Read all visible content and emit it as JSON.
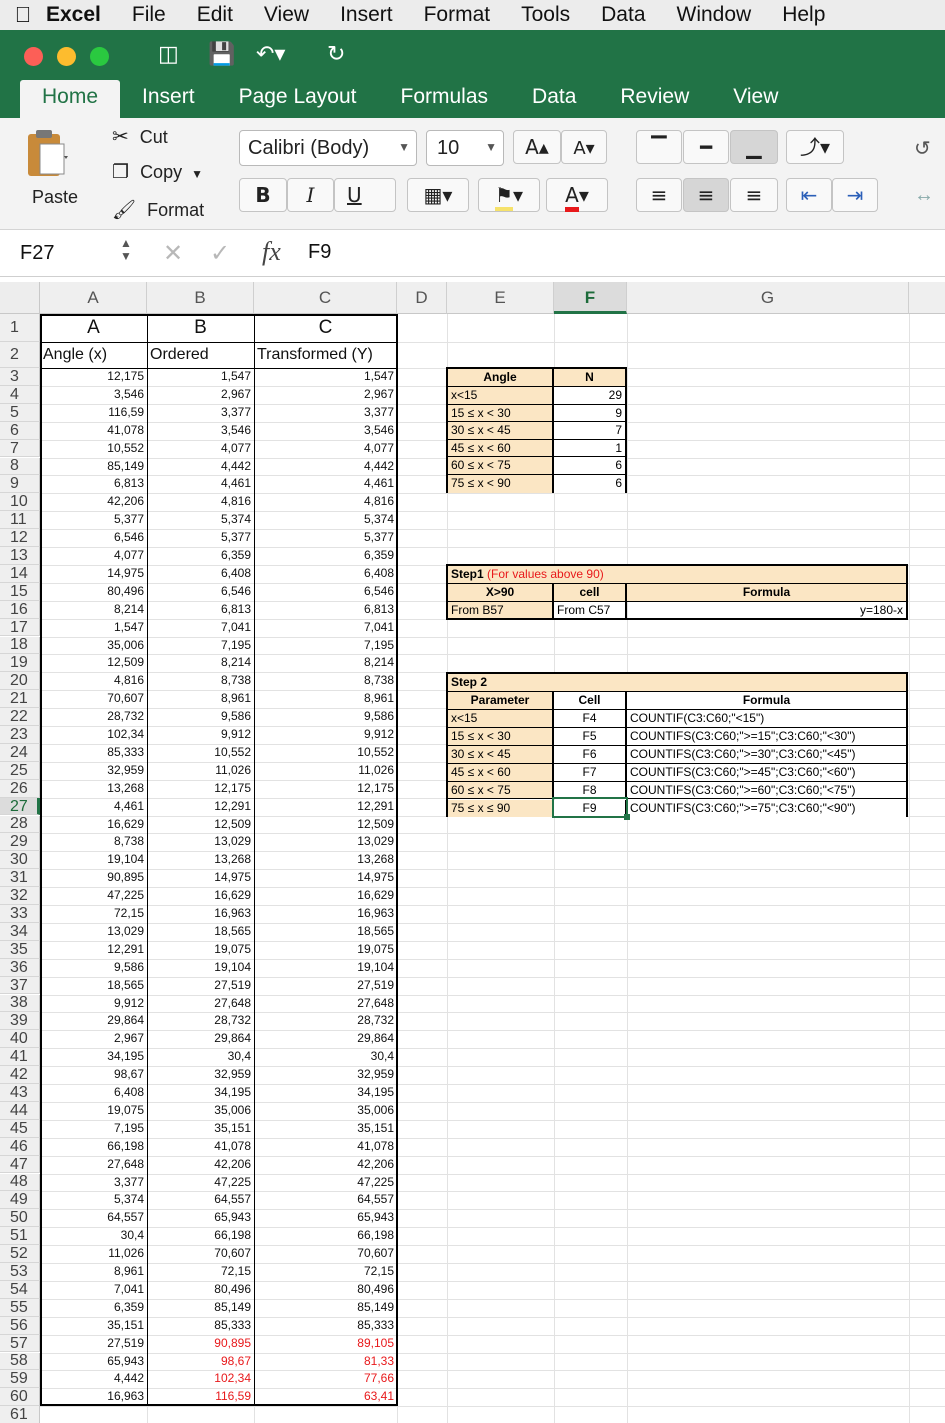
{
  "menubar": {
    "app": "Excel",
    "items": [
      "File",
      "Edit",
      "View",
      "Insert",
      "Format",
      "Tools",
      "Data",
      "Window",
      "Help"
    ]
  },
  "tabs": [
    "Home",
    "Insert",
    "Page Layout",
    "Formulas",
    "Data",
    "Review",
    "View"
  ],
  "ribbon": {
    "paste_label": "Paste",
    "cut_label": "Cut",
    "copy_label": "Copy",
    "format_label": "Format",
    "font_name": "Calibri (Body)",
    "font_size": "10",
    "bold": "B",
    "italic": "I",
    "underline": "U",
    "font_color_letter": "A"
  },
  "formula_bar": {
    "name_box": "F27",
    "formula": "F9",
    "fx": "fx"
  },
  "colors": {
    "title_green": "#217346",
    "highlight_tan": "#fbe6c4",
    "red_text": "#e8191b"
  },
  "columns": [
    "A",
    "B",
    "C",
    "D",
    "E",
    "F",
    "G"
  ],
  "row_numbers": [
    "1",
    "2",
    "3",
    "4",
    "5",
    "6",
    "7",
    "8",
    "9",
    "10",
    "11",
    "12",
    "13",
    "14",
    "15",
    "16",
    "17",
    "18",
    "19",
    "20",
    "21",
    "22",
    "23",
    "24",
    "25",
    "26",
    "27",
    "28",
    "29",
    "30",
    "31",
    "32",
    "33",
    "34",
    "35",
    "36",
    "37",
    "38",
    "39",
    "40",
    "41",
    "42",
    "43",
    "44",
    "45",
    "46",
    "47",
    "48",
    "49",
    "50",
    "51",
    "52",
    "53",
    "54",
    "55",
    "56",
    "57",
    "58",
    "59",
    "60",
    "61"
  ],
  "sheet": {
    "row1": [
      "A",
      "B",
      "C"
    ],
    "row2": [
      "Angle (x)",
      "Ordered",
      "Transformed (Y)"
    ],
    "data": [
      [
        "12,175",
        "1,547",
        "1,547"
      ],
      [
        "3,546",
        "2,967",
        "2,967"
      ],
      [
        "116,59",
        "3,377",
        "3,377"
      ],
      [
        "41,078",
        "3,546",
        "3,546"
      ],
      [
        "10,552",
        "4,077",
        "4,077"
      ],
      [
        "85,149",
        "4,442",
        "4,442"
      ],
      [
        "6,813",
        "4,461",
        "4,461"
      ],
      [
        "42,206",
        "4,816",
        "4,816"
      ],
      [
        "5,377",
        "5,374",
        "5,374"
      ],
      [
        "6,546",
        "5,377",
        "5,377"
      ],
      [
        "4,077",
        "6,359",
        "6,359"
      ],
      [
        "14,975",
        "6,408",
        "6,408"
      ],
      [
        "80,496",
        "6,546",
        "6,546"
      ],
      [
        "8,214",
        "6,813",
        "6,813"
      ],
      [
        "1,547",
        "7,041",
        "7,041"
      ],
      [
        "35,006",
        "7,195",
        "7,195"
      ],
      [
        "12,509",
        "8,214",
        "8,214"
      ],
      [
        "4,816",
        "8,738",
        "8,738"
      ],
      [
        "70,607",
        "8,961",
        "8,961"
      ],
      [
        "28,732",
        "9,586",
        "9,586"
      ],
      [
        "102,34",
        "9,912",
        "9,912"
      ],
      [
        "85,333",
        "10,552",
        "10,552"
      ],
      [
        "32,959",
        "11,026",
        "11,026"
      ],
      [
        "13,268",
        "12,175",
        "12,175"
      ],
      [
        "4,461",
        "12,291",
        "12,291"
      ],
      [
        "16,629",
        "12,509",
        "12,509"
      ],
      [
        "8,738",
        "13,029",
        "13,029"
      ],
      [
        "19,104",
        "13,268",
        "13,268"
      ],
      [
        "90,895",
        "14,975",
        "14,975"
      ],
      [
        "47,225",
        "16,629",
        "16,629"
      ],
      [
        "72,15",
        "16,963",
        "16,963"
      ],
      [
        "13,029",
        "18,565",
        "18,565"
      ],
      [
        "12,291",
        "19,075",
        "19,075"
      ],
      [
        "9,586",
        "19,104",
        "19,104"
      ],
      [
        "18,565",
        "27,519",
        "27,519"
      ],
      [
        "9,912",
        "27,648",
        "27,648"
      ],
      [
        "29,864",
        "28,732",
        "28,732"
      ],
      [
        "2,967",
        "29,864",
        "29,864"
      ],
      [
        "34,195",
        "30,4",
        "30,4"
      ],
      [
        "98,67",
        "32,959",
        "32,959"
      ],
      [
        "6,408",
        "34,195",
        "34,195"
      ],
      [
        "19,075",
        "35,006",
        "35,006"
      ],
      [
        "7,195",
        "35,151",
        "35,151"
      ],
      [
        "66,198",
        "41,078",
        "41,078"
      ],
      [
        "27,648",
        "42,206",
        "42,206"
      ],
      [
        "3,377",
        "47,225",
        "47,225"
      ],
      [
        "5,374",
        "64,557",
        "64,557"
      ],
      [
        "64,557",
        "65,943",
        "65,943"
      ],
      [
        "30,4",
        "66,198",
        "66,198"
      ],
      [
        "11,026",
        "70,607",
        "70,607"
      ],
      [
        "8,961",
        "72,15",
        "72,15"
      ],
      [
        "7,041",
        "80,496",
        "80,496"
      ],
      [
        "6,359",
        "85,149",
        "85,149"
      ],
      [
        "35,151",
        "85,333",
        "85,333"
      ],
      [
        "27,519",
        "90,895",
        "89,105"
      ],
      [
        "65,943",
        "98,67",
        "81,33"
      ],
      [
        "4,442",
        "102,34",
        "77,66"
      ],
      [
        "16,963",
        "116,59",
        "63,41"
      ]
    ],
    "red_from_data_index": 54
  },
  "angle_table": {
    "headers": [
      "Angle",
      "N"
    ],
    "rows": [
      [
        "x<15",
        "29"
      ],
      [
        "15 ≤ x < 30",
        "9"
      ],
      [
        "30 ≤ x < 45",
        "7"
      ],
      [
        "45 ≤ x < 60",
        "1"
      ],
      [
        "60 ≤ x < 75",
        "6"
      ],
      [
        "75 ≤ x < 90",
        "6"
      ]
    ]
  },
  "step1": {
    "title": "Step1",
    "note": "(For values above 90)",
    "headers": [
      "X>90",
      "cell",
      "Formula"
    ],
    "row": [
      "From B57",
      "From C57",
      "y=180-x"
    ]
  },
  "step2": {
    "title": "Step 2",
    "headers": [
      "Parameter",
      "Cell",
      "Formula"
    ],
    "rows": [
      [
        "x<15",
        "F4",
        "COUNTIF(C3:C60;\"<15\")"
      ],
      [
        "15 ≤ x < 30",
        "F5",
        "COUNTIFS(C3:C60;\">=15\";C3:C60;\"<30\")"
      ],
      [
        "30 ≤ x < 45",
        "F6",
        "COUNTIFS(C3:C60;\">=30\";C3:C60;\"<45\")"
      ],
      [
        "45 ≤ x < 60",
        "F7",
        "COUNTIFS(C3:C60;\">=45\";C3:C60;\"<60\")"
      ],
      [
        "60 ≤ x < 75",
        "F8",
        "COUNTIFS(C3:C60;\">=60\";C3:C60;\"<75\")"
      ],
      [
        "75 ≤ x ≤ 90",
        "F9",
        "COUNTIFS(C3:C60;\">=75\";C3:C60;\"<90\")"
      ]
    ]
  }
}
